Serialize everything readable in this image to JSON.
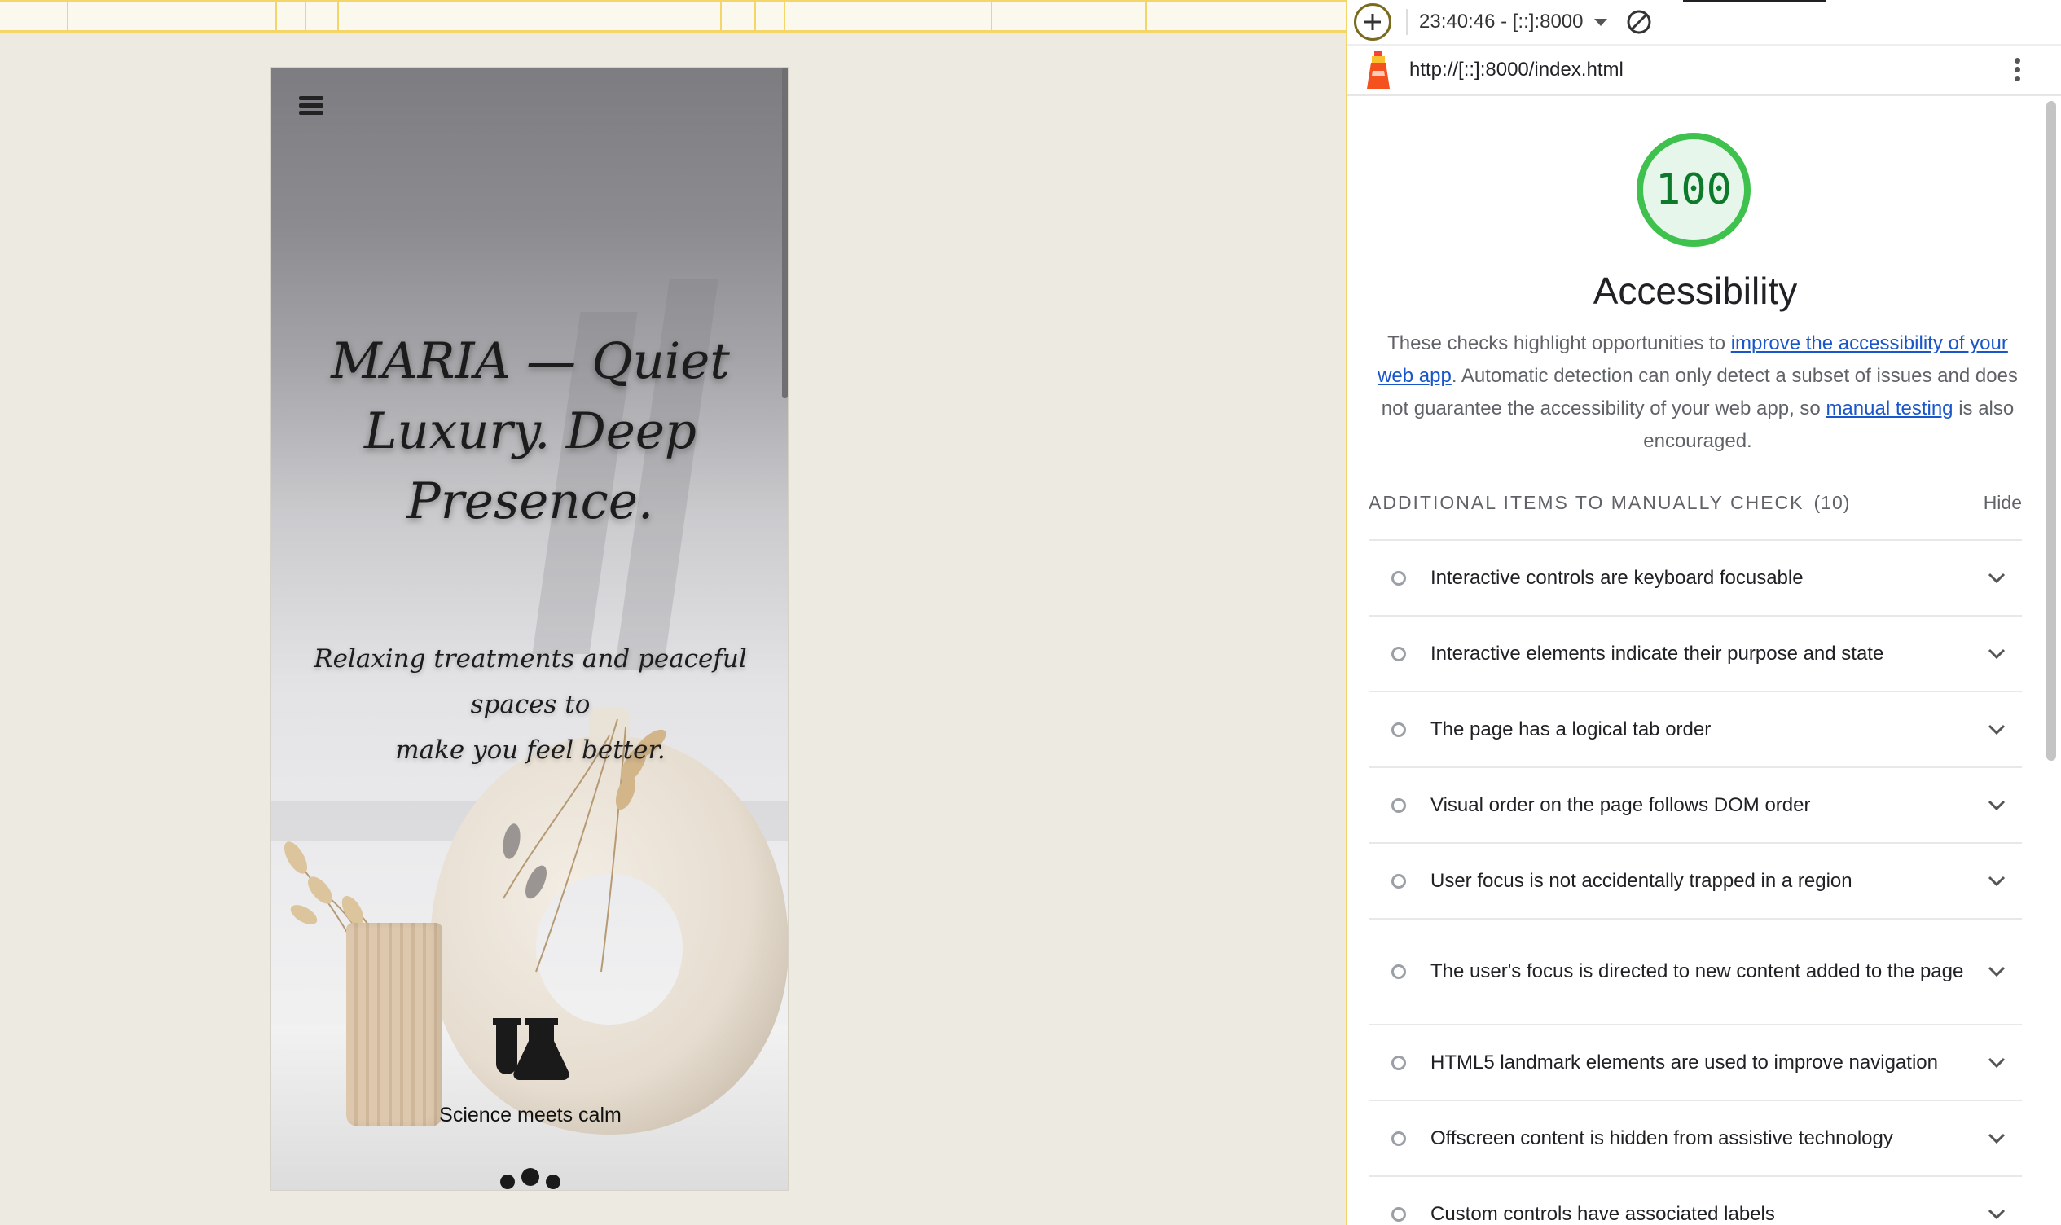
{
  "viewport": {
    "title_lines": [
      "MARIA — Quiet",
      "Luxury. Deep",
      "Presence."
    ],
    "subtitle_lines": [
      "Relaxing treatments and peaceful spaces to",
      "make you feel better."
    ],
    "feature_label": "Science meets calm"
  },
  "lighthouse": {
    "report_time": "23:40:46 - [::]:8000",
    "url": "http://[::]:8000/index.html",
    "score": "100",
    "score_color": "#0c7a2a",
    "category": "Accessibility",
    "description": {
      "part1": "These checks highlight opportunities to ",
      "link1": "improve the accessibility of your web app",
      "part2": ". Automatic detection can only detect a subset of issues and does not guarantee the accessibility of your web app, so ",
      "link2": "manual testing",
      "part3": " is also encouraged."
    },
    "group": {
      "title": "ADDITIONAL ITEMS TO MANUALLY CHECK",
      "count": "(10)",
      "hide": "Hide"
    },
    "audits": [
      "Interactive controls are keyboard focusable",
      "Interactive elements indicate their purpose and state",
      "The page has a logical tab order",
      "Visual order on the page follows DOM order",
      "User focus is not accidentally trapped in a region",
      "The user's focus is directed to new content added to the page",
      "HTML5 landmark elements are used to improve navigation",
      "Offscreen content is hidden from assistive technology",
      "Custom controls have associated labels"
    ]
  }
}
